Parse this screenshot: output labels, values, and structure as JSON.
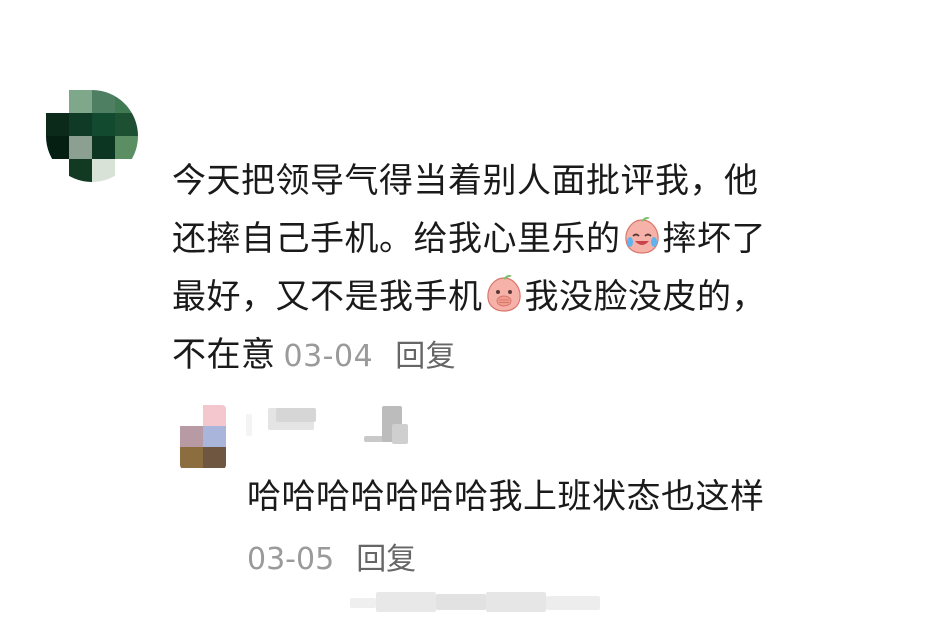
{
  "comment": {
    "avatar_name": "pixelated-avatar",
    "lines": [
      "今天把领导气得当着别人面批评我，他",
      "还摔自己手机。给我心里乐的",
      "摔坏了",
      "最好，又不是我手机",
      "我没脸没皮的，",
      "不在意"
    ],
    "date": "03-04",
    "reply_label": "回复",
    "emojis": [
      "crying-laughing-peach-icon",
      "covering-mouth-peach-icon"
    ]
  },
  "reply": {
    "avatar_name": "pixelated-avatar-small",
    "username": "",
    "text": "哈哈哈哈哈哈哈我上班状态也这样",
    "date": "03-05",
    "reply_label": "回复"
  },
  "colors": {
    "text": "#1a1a1a",
    "meta": "#9a9a9a",
    "action": "#666666",
    "background": "#ffffff"
  }
}
